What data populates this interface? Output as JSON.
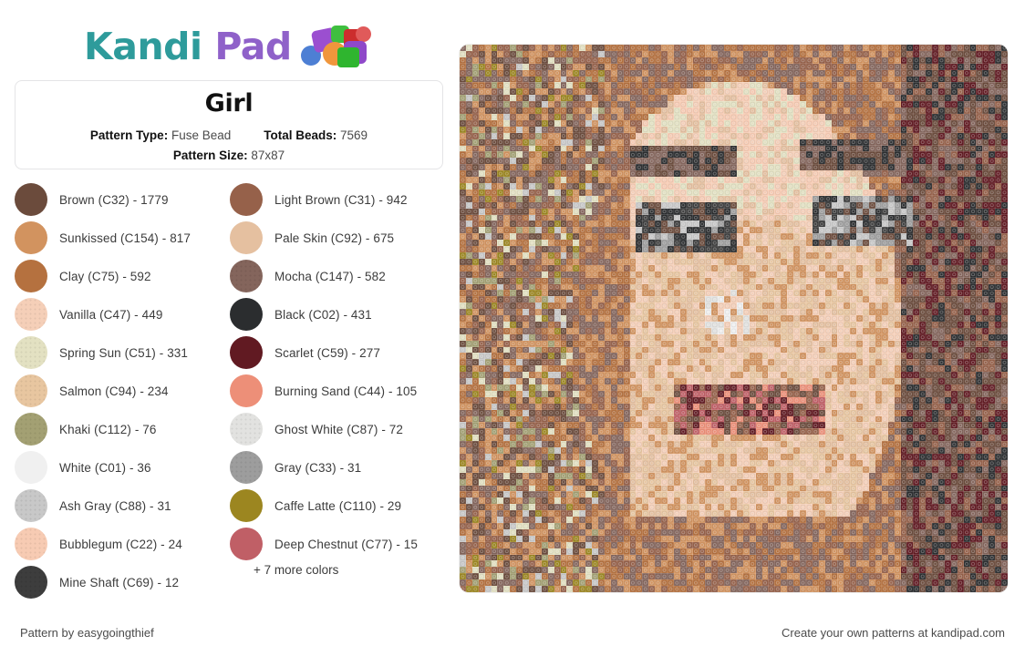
{
  "brand": {
    "name_part1": "Kandi",
    "name_part2": "Pad",
    "color_teal": "#2e9b9b",
    "color_purple": "#8f61c9"
  },
  "info_card": {
    "title": "Girl",
    "pattern_type_label": "Pattern Type:",
    "pattern_type_value": "Fuse Bead",
    "total_beads_label": "Total Beads:",
    "total_beads_value": "7569",
    "pattern_size_label": "Pattern Size:",
    "pattern_size_value": "87x87"
  },
  "legend": {
    "more_colors_text": "+ 7 more colors",
    "items": [
      {
        "name": "Brown",
        "code": "C32",
        "count": 1779,
        "label": "Brown (C32) - 1779",
        "hex": "#6b4b3c",
        "textured": false
      },
      {
        "name": "Light Brown",
        "code": "C31",
        "count": 942,
        "label": "Light Brown (C31) - 942",
        "hex": "#96614a",
        "textured": false
      },
      {
        "name": "Sunkissed",
        "code": "C154",
        "count": 817,
        "label": "Sunkissed (C154) - 817",
        "hex": "#d2935f",
        "textured": false
      },
      {
        "name": "Pale Skin",
        "code": "C92",
        "count": 675,
        "label": "Pale Skin (C92) - 675",
        "hex": "#e5c0a0",
        "textured": false
      },
      {
        "name": "Clay",
        "code": "C75",
        "count": 592,
        "label": "Clay (C75) - 592",
        "hex": "#b5713f",
        "textured": false
      },
      {
        "name": "Mocha",
        "code": "C147",
        "count": 582,
        "label": "Mocha (C147) - 582",
        "hex": "#84655c",
        "textured": true
      },
      {
        "name": "Vanilla",
        "code": "C47",
        "count": 449,
        "label": "Vanilla (C47) - 449",
        "hex": "#f5cfb8",
        "textured": true
      },
      {
        "name": "Black",
        "code": "C02",
        "count": 431,
        "label": "Black (C02) - 431",
        "hex": "#2b2d2f",
        "textured": false
      },
      {
        "name": "Spring Sun",
        "code": "C51",
        "count": 331,
        "label": "Spring Sun (C51) - 331",
        "hex": "#e3e1c2",
        "textured": true
      },
      {
        "name": "Scarlet",
        "code": "C59",
        "count": 277,
        "label": "Scarlet (C59) - 277",
        "hex": "#611a22",
        "textured": false
      },
      {
        "name": "Salmon",
        "code": "C94",
        "count": 234,
        "label": "Salmon (C94) - 234",
        "hex": "#e8c6a0",
        "textured": true
      },
      {
        "name": "Burning Sand",
        "code": "C44",
        "count": 105,
        "label": "Burning Sand (C44) - 105",
        "hex": "#ed8f78",
        "textured": false
      },
      {
        "name": "Khaki",
        "code": "C112",
        "count": 76,
        "label": "Khaki (C112) - 76",
        "hex": "#a3a073",
        "textured": true
      },
      {
        "name": "Ghost White",
        "code": "C87",
        "count": 72,
        "label": "Ghost White (C87) - 72",
        "hex": "#e2e2e0",
        "textured": true
      },
      {
        "name": "White",
        "code": "C01",
        "count": 36,
        "label": "White (C01) - 36",
        "hex": "#f0f0f0",
        "textured": false
      },
      {
        "name": "Gray",
        "code": "C33",
        "count": 31,
        "label": "Gray (C33) - 31",
        "hex": "#9d9d9d",
        "textured": true
      },
      {
        "name": "Ash Gray",
        "code": "C88",
        "count": 31,
        "label": "Ash Gray (C88) - 31",
        "hex": "#c8c8c8",
        "textured": true
      },
      {
        "name": "Caffe Latte",
        "code": "C110",
        "count": 29,
        "label": "Caffe Latte (C110) - 29",
        "hex": "#9c8620",
        "textured": false
      },
      {
        "name": "Bubblegum",
        "code": "C22",
        "count": 24,
        "label": "Bubblegum (C22) - 24",
        "hex": "#f7cbb3",
        "textured": true
      },
      {
        "name": "Deep Chestnut",
        "code": "C77",
        "count": 15,
        "label": "Deep Chestnut (C77) - 15",
        "hex": "#c05f66",
        "textured": false
      },
      {
        "name": "Mine Shaft",
        "code": "C69",
        "count": 12,
        "label": "Mine Shaft (C69) - 12",
        "hex": "#3d3d3d",
        "textured": true
      }
    ]
  },
  "preview": {
    "alt": "Girl fuse bead pattern preview",
    "grid_size": 87
  },
  "footer": {
    "credit": "Pattern by easygoingthief",
    "promo": "Create your own patterns at kandipad.com"
  }
}
